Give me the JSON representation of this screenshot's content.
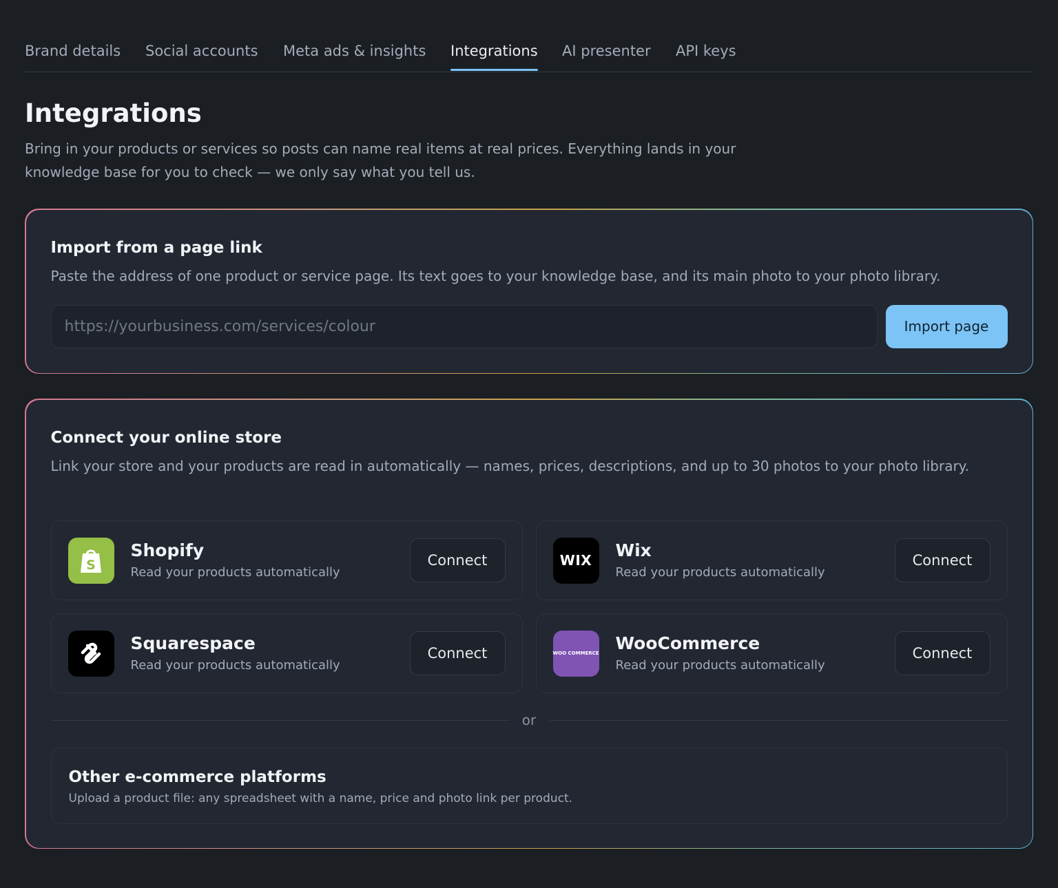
{
  "tabs": [
    {
      "label": "Brand details"
    },
    {
      "label": "Social accounts"
    },
    {
      "label": "Meta ads & insights"
    },
    {
      "label": "Integrations"
    },
    {
      "label": "AI presenter"
    },
    {
      "label": "API keys"
    }
  ],
  "active_tab": "Integrations",
  "page": {
    "title": "Integrations",
    "intro": "Bring in your products or services so posts can name real items at real prices. Everything lands in your knowledge base for you to check — we only say what you tell us."
  },
  "import_card": {
    "title": "Import from a page link",
    "description": "Paste the address of one product or service page. Its text goes to your knowledge base, and its main photo to your photo library.",
    "input_value": "",
    "input_placeholder": "https://yourbusiness.com/services/colour",
    "button_label": "Import page"
  },
  "store_card": {
    "title": "Connect your online store",
    "description": "Link your store and your products are read in automatically — names, prices, descriptions, and up to 30 photos to your photo library.",
    "stores": [
      {
        "name": "Shopify",
        "subtitle": "Read your products automatically",
        "button": "Connect",
        "icon": "shopify-icon",
        "color": "#95bf47"
      },
      {
        "name": "Wix",
        "subtitle": "Read your products automatically",
        "button": "Connect",
        "icon": "wix-icon",
        "logo_text": "WIX",
        "color": "#000000"
      },
      {
        "name": "Squarespace",
        "subtitle": "Read your products automatically",
        "button": "Connect",
        "icon": "squarespace-icon",
        "color": "#000000"
      },
      {
        "name": "WooCommerce",
        "subtitle": "Read your products automatically",
        "button": "Connect",
        "icon": "woocommerce-icon",
        "logo_text": "WOO COMMERCE",
        "color": "#7f54b3"
      }
    ],
    "divider_text": "or",
    "other": {
      "title": "Other e-commerce platforms",
      "subtitle": "Upload a product file: any spreadsheet with a name, price and photo link per product."
    }
  },
  "colors": {
    "background": "#1b1e23",
    "card": "#222731",
    "accent": "#7cc4f5"
  }
}
